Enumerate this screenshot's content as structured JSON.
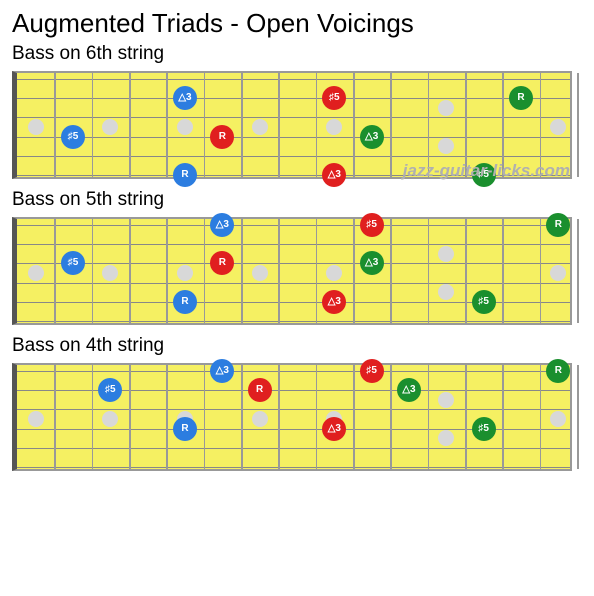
{
  "title": "Augmented Triads - Open Voicings",
  "watermark": "jazz-guitar-licks.com",
  "colors": {
    "blue": "#2c7de0",
    "red": "#e01f1f",
    "green": "#1a8f2e"
  },
  "chart_data": [
    {
      "type": "fretboard-diagram",
      "title": "Bass on 6th string",
      "strings": 6,
      "frets": 15,
      "inlay_frets": [
        1,
        3,
        5,
        7,
        9,
        12,
        15
      ],
      "double_inlay_frets": [
        12
      ],
      "dots": [
        {
          "fret": 2,
          "string": 4,
          "color": "blue",
          "label": "♯5"
        },
        {
          "fret": 5,
          "string": 6,
          "color": "blue",
          "label": "R"
        },
        {
          "fret": 5,
          "string": 2,
          "color": "blue",
          "label": "△3"
        },
        {
          "fret": 6,
          "string": 4,
          "color": "red",
          "label": "R"
        },
        {
          "fret": 9,
          "string": 6,
          "color": "red",
          "label": "△3"
        },
        {
          "fret": 9,
          "string": 2,
          "color": "red",
          "label": "♯5"
        },
        {
          "fret": 10,
          "string": 4,
          "color": "green",
          "label": "△3"
        },
        {
          "fret": 13,
          "string": 6,
          "color": "green",
          "label": "♯5"
        },
        {
          "fret": 14,
          "string": 2,
          "color": "green",
          "label": "R"
        }
      ]
    },
    {
      "type": "fretboard-diagram",
      "title": "Bass on 5th string",
      "strings": 6,
      "frets": 15,
      "inlay_frets": [
        1,
        3,
        5,
        7,
        9,
        12,
        15
      ],
      "double_inlay_frets": [
        12
      ],
      "dots": [
        {
          "fret": 2,
          "string": 3,
          "color": "blue",
          "label": "♯5"
        },
        {
          "fret": 5,
          "string": 5,
          "color": "blue",
          "label": "R"
        },
        {
          "fret": 6,
          "string": 1,
          "color": "blue",
          "label": "△3"
        },
        {
          "fret": 6,
          "string": 3,
          "color": "red",
          "label": "R"
        },
        {
          "fret": 9,
          "string": 5,
          "color": "red",
          "label": "△3"
        },
        {
          "fret": 10,
          "string": 1,
          "color": "red",
          "label": "♯5"
        },
        {
          "fret": 10,
          "string": 3,
          "color": "green",
          "label": "△3"
        },
        {
          "fret": 13,
          "string": 5,
          "color": "green",
          "label": "♯5"
        },
        {
          "fret": 15,
          "string": 1,
          "color": "green",
          "label": "R"
        }
      ]
    },
    {
      "type": "fretboard-diagram",
      "title": "Bass on 4th string",
      "strings": 6,
      "frets": 15,
      "inlay_frets": [
        1,
        3,
        5,
        7,
        9,
        12,
        15
      ],
      "double_inlay_frets": [
        12
      ],
      "dots": [
        {
          "fret": 3,
          "string": 2,
          "color": "blue",
          "label": "♯5"
        },
        {
          "fret": 5,
          "string": 4,
          "color": "blue",
          "label": "R"
        },
        {
          "fret": 6,
          "string": 1,
          "color": "blue",
          "label": "△3"
        },
        {
          "fret": 7,
          "string": 2,
          "color": "red",
          "label": "R"
        },
        {
          "fret": 9,
          "string": 4,
          "color": "red",
          "label": "△3"
        },
        {
          "fret": 10,
          "string": 1,
          "color": "red",
          "label": "♯5"
        },
        {
          "fret": 11,
          "string": 2,
          "color": "green",
          "label": "△3"
        },
        {
          "fret": 13,
          "string": 4,
          "color": "green",
          "label": "♯5"
        },
        {
          "fret": 15,
          "string": 1,
          "color": "green",
          "label": "R"
        }
      ]
    }
  ]
}
